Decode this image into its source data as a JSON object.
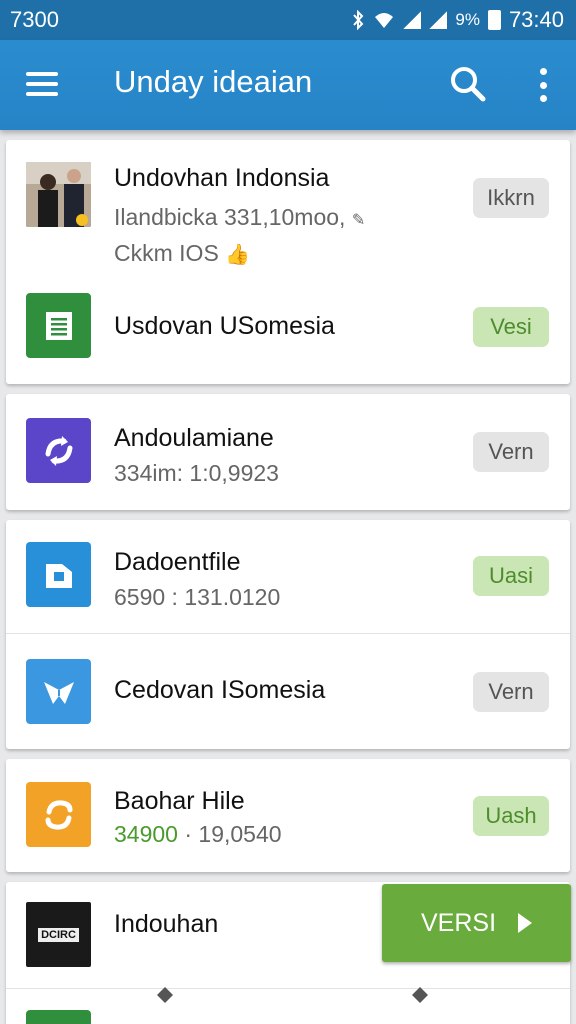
{
  "status_bar": {
    "left_text": "7300",
    "battery": "9%",
    "time": "73:40",
    "icons": [
      "bluetooth-icon",
      "wifi-icon",
      "signal-icon",
      "signal-icon",
      "battery-icon"
    ]
  },
  "app_bar": {
    "title": "Unday ideaian",
    "icons": [
      "menu-icon",
      "search-icon",
      "more-vert-icon"
    ],
    "color": "#2a8ccf"
  },
  "cards": [
    {
      "rows": [
        {
          "title": "Undovhan Indonsia",
          "sub1": "Ilandbicka 331,10moo,",
          "sub2": "Ckkm IOS",
          "button": "Ikkrn",
          "button_style": "gray",
          "icon": "photo-thumbnail"
        },
        {
          "title": "Usdovan USomesia",
          "button": "Vesi",
          "button_style": "green",
          "icon": "document-icon",
          "icon_color": "#2f8f3c"
        }
      ]
    },
    {
      "rows": [
        {
          "title": "Andoulamiane",
          "sub1": "334im: 1:0,9923",
          "button": "Vern",
          "button_style": "gray",
          "icon": "sync-icon",
          "icon_color": "#5b45c8"
        }
      ]
    },
    {
      "rows": [
        {
          "title": "Dadoentfile",
          "sub1": "6590 : 131.0120",
          "button": "Uasi",
          "button_style": "green",
          "icon": "file-icon",
          "icon_color": "#2790d8"
        },
        {
          "title": "Cedovan ISomesia",
          "button": "Vern",
          "button_style": "gray",
          "icon": "bird-icon",
          "icon_color": "#3a97e0"
        }
      ]
    },
    {
      "rows": [
        {
          "title": "Baohar Hile",
          "sub1_green": "34900",
          "sub1_rest": " · 19,0540",
          "button": "Uash",
          "button_style": "green",
          "icon": "refresh-icon",
          "icon_color": "#f2a227"
        }
      ]
    },
    {
      "rows": [
        {
          "title": "Indouhan",
          "thumb_text": "DCIRC",
          "icon": "video-thumbnail"
        }
      ]
    }
  ],
  "action_button": {
    "label": "VERSI",
    "icon": "play-arrow-icon",
    "color": "#69ab3c"
  }
}
